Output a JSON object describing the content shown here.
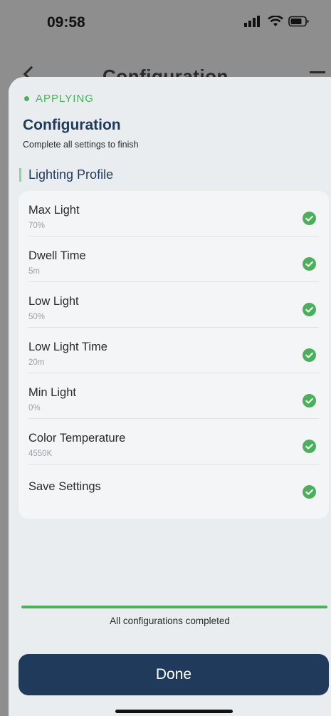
{
  "status_bar": {
    "time": "09:58",
    "icons": [
      "signal-icon",
      "wifi-icon",
      "battery-icon"
    ]
  },
  "background_nav": {
    "title": "Configuration",
    "icons": [
      "back-chevron-icon",
      "menu-icon"
    ]
  },
  "sheet": {
    "status": "APPLYING",
    "title": "Configuration",
    "subtitle": "Complete all settings to finish",
    "section": "Lighting Profile",
    "items": [
      {
        "label": "Max Light",
        "value": "70%",
        "done": true
      },
      {
        "label": "Dwell Time",
        "value": "5m",
        "done": true
      },
      {
        "label": "Low Light",
        "value": "50%",
        "done": true
      },
      {
        "label": "Low Light Time",
        "value": "20m",
        "done": true
      },
      {
        "label": "Min Light",
        "value": "0%",
        "done": true
      },
      {
        "label": "Color Temperature",
        "value": "4550K",
        "done": true
      },
      {
        "label": "Save Settings",
        "value": "",
        "done": true
      }
    ],
    "progress": 1.0,
    "progress_text": "All configurations completed",
    "done_label": "Done"
  },
  "colors": {
    "accent_green": "#4bb05a",
    "primary_navy": "#1f3a5b",
    "sheet_bg": "#e9edf0",
    "card_bg": "#f3f5f7"
  }
}
